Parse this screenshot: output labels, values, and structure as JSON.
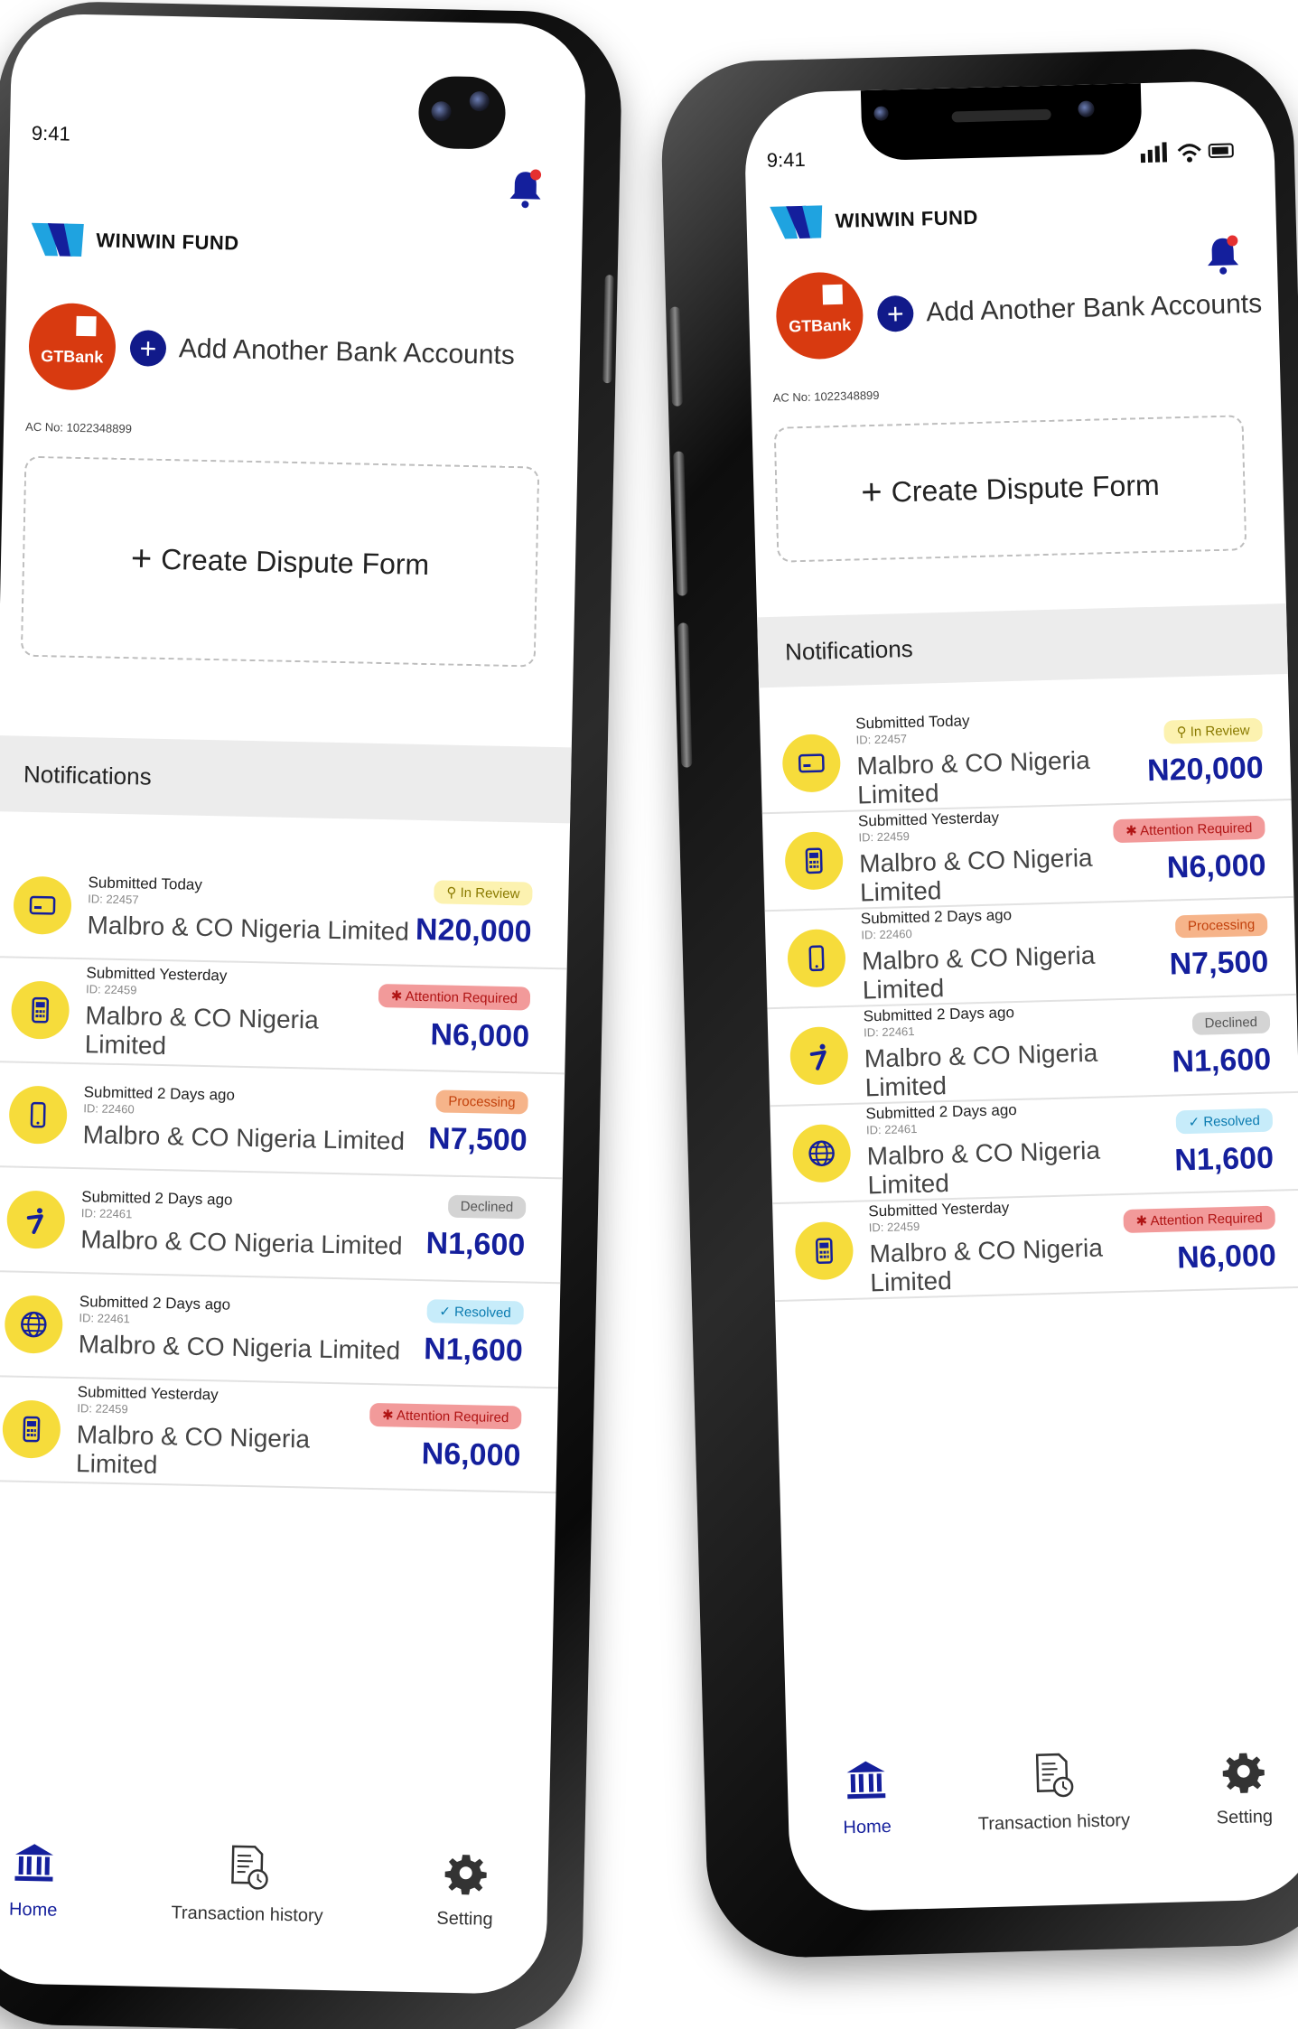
{
  "app": {
    "status_time": "9:41",
    "logo_text": "WINWIN FUND",
    "bank_label": "GTBank",
    "account_no": "AC No: 1022348899",
    "add_bank_label": "Add Another Bank Accounts",
    "dispute_label": "Create Dispute Form",
    "notifications_title": "Notifications"
  },
  "left_items": [
    {
      "icon": "card-icon",
      "sub": "Submitted Today",
      "id": "ID: 22457",
      "name": "Malbro & CO Nigeria Limited",
      "status": "In Review",
      "status_type": "review",
      "amount": "N20,000"
    },
    {
      "icon": "pos-terminal-icon",
      "sub": "Submitted Yesterday",
      "id": "ID: 22459",
      "name": "Malbro & CO Nigeria Limited",
      "status": "Attention Required",
      "status_type": "attention",
      "amount": "N6,000"
    },
    {
      "icon": "phone-icon",
      "sub": "Submitted 2 Days ago",
      "id": "ID: 22460",
      "name": "Malbro & CO Nigeria Limited",
      "status": "Processing",
      "status_type": "processing",
      "amount": "N7,500"
    },
    {
      "icon": "interswitch-icon",
      "sub": "Submitted 2 Days ago",
      "id": "ID: 22461",
      "name": "Malbro & CO Nigeria Limited",
      "status": "Declined",
      "status_type": "declined",
      "amount": "N1,600"
    },
    {
      "icon": "globe-icon",
      "sub": "Submitted 2 Days ago",
      "id": "ID: 22461",
      "name": "Malbro & CO Nigeria Limited",
      "status": "Resolved",
      "status_type": "resolved",
      "amount": "N1,600"
    },
    {
      "icon": "pos-terminal-icon",
      "sub": "Submitted Yesterday",
      "id": "ID: 22459",
      "name": "Malbro & CO Nigeria Limited",
      "status": "Attention Required",
      "status_type": "attention",
      "amount": "N6,000"
    }
  ],
  "tabs": [
    {
      "label": "Home",
      "icon": "bank-icon",
      "active": true
    },
    {
      "label": "Transaction history",
      "icon": "document-clock-icon",
      "active": false
    },
    {
      "label": "Setting",
      "icon": "gear-icon",
      "active": false
    }
  ],
  "colors": {
    "accent": "#141f9c",
    "icon_bg": "#f6dc3b",
    "gtbank": "#d83a10",
    "review": "#fcf2b0",
    "attention": "#f29a9a",
    "processing": "#f6b48a",
    "declined": "#d4d4d4",
    "resolved": "#c7ecfa"
  }
}
